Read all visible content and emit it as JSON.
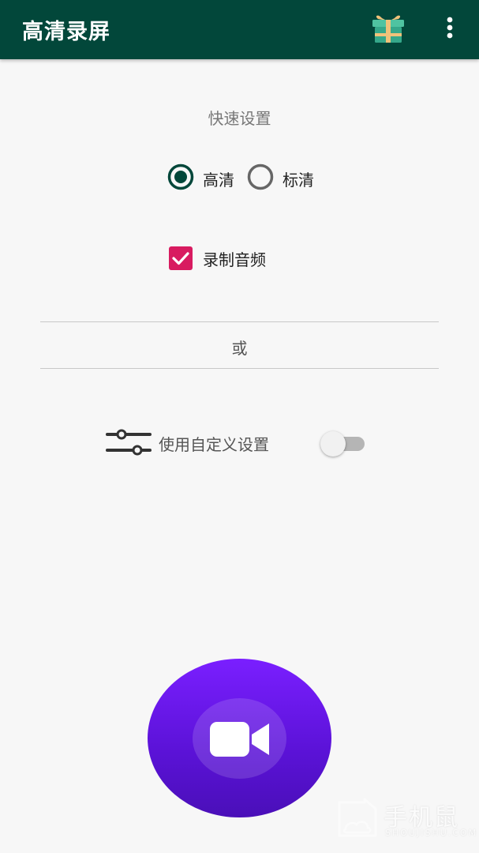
{
  "app_bar": {
    "title": "高清录屏",
    "gift_icon": "gift-box-icon",
    "more_icon": "more-vert-icon"
  },
  "quick_settings": {
    "title": "快速设置",
    "quality_options": [
      {
        "label": "高清",
        "selected": true
      },
      {
        "label": "标清",
        "selected": false
      }
    ],
    "record_audio": {
      "label": "录制音频",
      "checked": true
    }
  },
  "or_text": "或",
  "custom_settings": {
    "label": "使用自定义设置",
    "icon": "tune-sliders-icon",
    "enabled": false
  },
  "record_button": {
    "icon": "videocam-icon"
  },
  "watermark": {
    "cn": "手机鼠",
    "en": "SHOUJISHU.COM"
  },
  "colors": {
    "app_bar": "#02473a",
    "accent_radio": "#02473a",
    "checkbox": "#d81b60",
    "record_top": "#7a1fff",
    "record_bottom": "#4a0fb8"
  }
}
